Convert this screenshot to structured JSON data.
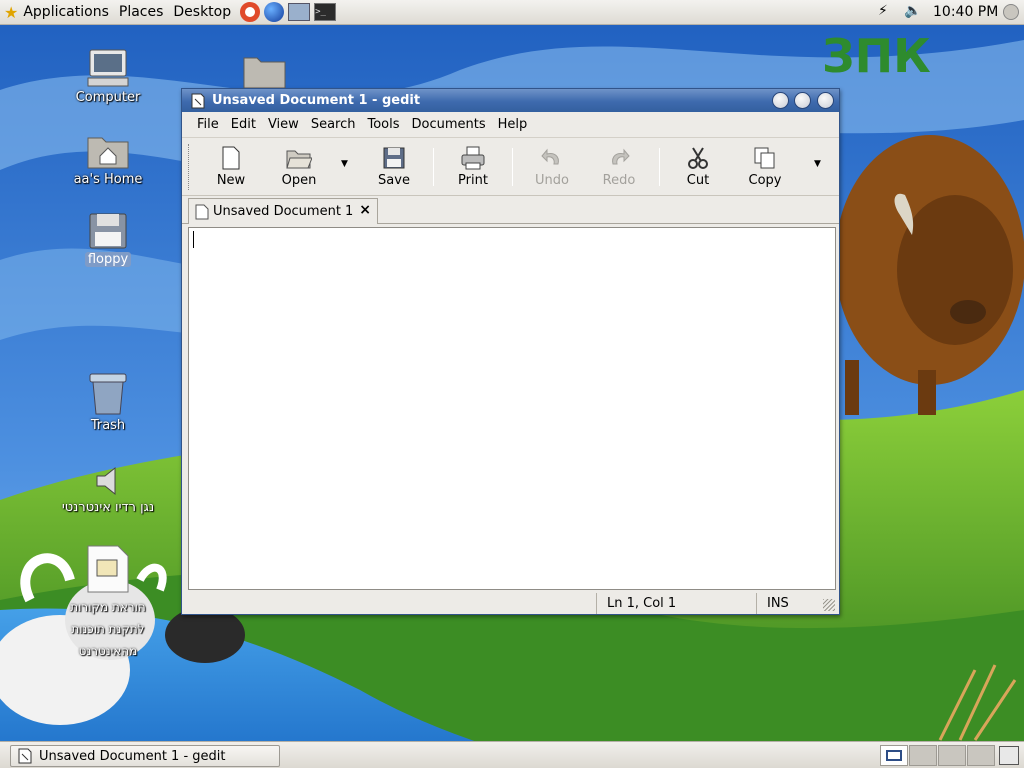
{
  "top_panel": {
    "menus": [
      "Applications",
      "Places",
      "Desktop"
    ],
    "clock": "10:40 PM"
  },
  "desktop_icons": [
    {
      "label": "Computer"
    },
    {
      "label": "aa's Home"
    },
    {
      "label": "floppy",
      "selected": true
    },
    {
      "label": "Trash"
    },
    {
      "label": "נגן רדיו אינטרנטי"
    },
    {
      "label": "הוראת מקורות לתקנת תוכנות מהאינטרנט"
    }
  ],
  "wallpaper": {
    "logo_text": "ЗПК"
  },
  "window": {
    "title": "Unsaved Document 1 - gedit",
    "menu": [
      "File",
      "Edit",
      "View",
      "Search",
      "Tools",
      "Documents",
      "Help"
    ],
    "toolbar": {
      "new": "New",
      "open": "Open",
      "save": "Save",
      "print": "Print",
      "undo": "Undo",
      "redo": "Redo",
      "cut": "Cut",
      "copy": "Copy"
    },
    "tab_label": "Unsaved Document 1",
    "tab_close": "×",
    "editor_text": "",
    "status": {
      "position": "Ln 1, Col 1",
      "mode": "INS"
    }
  },
  "bottom_panel": {
    "task_label": "Unsaved Document 1 - gedit"
  },
  "colors": {
    "titlebar": "#3e6aae",
    "sky": "#3f7fd6",
    "grass": "#4f9a2a"
  }
}
